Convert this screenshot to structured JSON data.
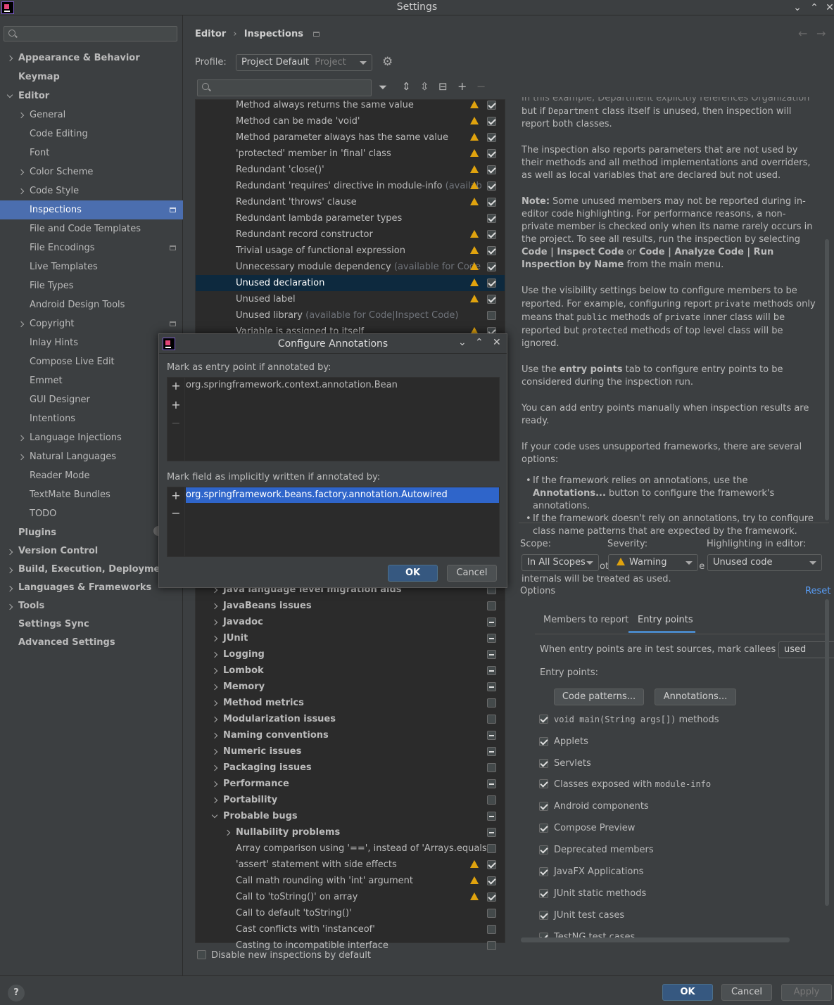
{
  "window": {
    "title": "Settings"
  },
  "search": {
    "placeholder": ""
  },
  "sidebar": {
    "items": [
      {
        "label": "Appearance & Behavior",
        "level": 0,
        "bold": true,
        "expand": "collapsed"
      },
      {
        "label": "Keymap",
        "level": 0,
        "bold": true
      },
      {
        "label": "Editor",
        "level": 0,
        "bold": true,
        "expand": "expanded"
      },
      {
        "label": "General",
        "level": 1,
        "expand": "collapsed"
      },
      {
        "label": "Code Editing",
        "level": 1
      },
      {
        "label": "Font",
        "level": 1
      },
      {
        "label": "Color Scheme",
        "level": 1,
        "expand": "collapsed"
      },
      {
        "label": "Code Style",
        "level": 1,
        "expand": "collapsed"
      },
      {
        "label": "Inspections",
        "level": 1,
        "selected": true,
        "project": true
      },
      {
        "label": "File and Code Templates",
        "level": 1
      },
      {
        "label": "File Encodings",
        "level": 1,
        "project": true
      },
      {
        "label": "Live Templates",
        "level": 1
      },
      {
        "label": "File Types",
        "level": 1
      },
      {
        "label": "Android Design Tools",
        "level": 1
      },
      {
        "label": "Copyright",
        "level": 1,
        "expand": "collapsed",
        "project": true
      },
      {
        "label": "Inlay Hints",
        "level": 1
      },
      {
        "label": "Compose Live Edit",
        "level": 1
      },
      {
        "label": "Emmet",
        "level": 1
      },
      {
        "label": "GUI Designer",
        "level": 1
      },
      {
        "label": "Intentions",
        "level": 1
      },
      {
        "label": "Language Injections",
        "level": 1,
        "expand": "collapsed"
      },
      {
        "label": "Natural Languages",
        "level": 1,
        "expand": "collapsed"
      },
      {
        "label": "Reader Mode",
        "level": 1
      },
      {
        "label": "TextMate Bundles",
        "level": 1
      },
      {
        "label": "TODO",
        "level": 1
      },
      {
        "label": "Plugins",
        "level": 0,
        "bold": true
      },
      {
        "label": "Version Control",
        "level": 0,
        "bold": true,
        "expand": "collapsed"
      },
      {
        "label": "Build, Execution, Deployment",
        "level": 0,
        "bold": true,
        "expand": "collapsed"
      },
      {
        "label": "Languages & Frameworks",
        "level": 0,
        "bold": true,
        "expand": "collapsed"
      },
      {
        "label": "Tools",
        "level": 0,
        "bold": true,
        "expand": "collapsed"
      },
      {
        "label": "Settings Sync",
        "level": 0,
        "bold": true
      },
      {
        "label": "Advanced Settings",
        "level": 0,
        "bold": true
      }
    ]
  },
  "breadcrumb": {
    "parent": "Editor",
    "current": "Inspections",
    "sep": "›"
  },
  "profile": {
    "label": "Profile:",
    "value": "Project Default",
    "scope": "Project"
  },
  "filter": {
    "placeholder": ""
  },
  "inspections_top": [
    {
      "label": "Method always returns the same value",
      "warn": true,
      "check": "on"
    },
    {
      "label": "Method can be made 'void'",
      "warn": true,
      "check": "on"
    },
    {
      "label": "Method parameter always has the same value",
      "warn": true,
      "check": "on"
    },
    {
      "label": "'protected' member in 'final' class",
      "warn": true,
      "check": "on"
    },
    {
      "label": "Redundant 'close()'",
      "warn": true,
      "check": "on"
    },
    {
      "label": "Redundant 'requires' directive in module-info",
      "suffix": " (availab",
      "warn": true,
      "check": "on"
    },
    {
      "label": "Redundant 'throws' clause",
      "warn": true,
      "check": "on"
    },
    {
      "label": "Redundant lambda parameter types",
      "warn": false,
      "check": "on"
    },
    {
      "label": "Redundant record constructor",
      "warn": true,
      "check": "on"
    },
    {
      "label": "Trivial usage of functional expression",
      "warn": true,
      "check": "on"
    },
    {
      "label": "Unnecessary module dependency",
      "suffix": " (available for Code",
      "warn": true,
      "check": "on"
    },
    {
      "label": "Unused declaration",
      "warn": true,
      "check": "on",
      "selected": true
    },
    {
      "label": "Unused label",
      "warn": true,
      "check": "on"
    },
    {
      "label": "Unused library",
      "suffix": " (available for Code|Inspect Code)",
      "warn": false,
      "check": "off"
    },
    {
      "label": "Variable is assigned to itself",
      "warn": true,
      "check": "on"
    }
  ],
  "inspections_bottom": [
    {
      "label": "Java language level migration aids",
      "group": true,
      "check": "off"
    },
    {
      "label": "JavaBeans issues",
      "group": true,
      "check": "off"
    },
    {
      "label": "Javadoc",
      "group": true,
      "check": "mix"
    },
    {
      "label": "JUnit",
      "group": true,
      "check": "mix"
    },
    {
      "label": "Logging",
      "group": true,
      "check": "mix"
    },
    {
      "label": "Lombok",
      "group": true,
      "check": "mix"
    },
    {
      "label": "Memory",
      "group": true,
      "check": "mix"
    },
    {
      "label": "Method metrics",
      "group": true,
      "check": "off"
    },
    {
      "label": "Modularization issues",
      "group": true,
      "check": "off"
    },
    {
      "label": "Naming conventions",
      "group": true,
      "check": "mix"
    },
    {
      "label": "Numeric issues",
      "group": true,
      "check": "mix"
    },
    {
      "label": "Packaging issues",
      "group": true,
      "check": "off"
    },
    {
      "label": "Performance",
      "group": true,
      "check": "mix"
    },
    {
      "label": "Portability",
      "group": true,
      "check": "off"
    },
    {
      "label": "Probable bugs",
      "group": true,
      "expanded": true,
      "check": "mix"
    },
    {
      "label": "Nullability problems",
      "group": true,
      "sub": true,
      "check": "mix"
    },
    {
      "label": "Array comparison using '==', instead of 'Arrays.equals",
      "check": "off"
    },
    {
      "label": "'assert' statement with side effects",
      "warn": true,
      "check": "on"
    },
    {
      "label": "Call math rounding with 'int' argument",
      "warn": true,
      "check": "on"
    },
    {
      "label": "Call to 'toString()' on array",
      "warn": true,
      "check": "on"
    },
    {
      "label": "Call to default 'toString()'",
      "check": "off"
    },
    {
      "label": "Cast conflicts with 'instanceof'",
      "check": "off"
    },
    {
      "label": "Casting to incompatible interface",
      "check": "off"
    }
  ],
  "disable_new": {
    "label": "Disable new inspections by default",
    "checked": false
  },
  "description": {
    "p0_cut": "In this example, Department explicitly references Organization",
    "p0_a": "but if ",
    "p0_code": "Department",
    "p0_b": " class itself is unused, then inspection will report both classes.",
    "p1": "The inspection also reports parameters that are not used by their methods and all method implementations and overriders, as well as local variables that are declared but not used.",
    "p2_note": "Note:",
    "p2_a": " Some unused members may not be reported during in-editor code highlighting. For performance reasons, a non-private member is checked only when its name rarely occurs in the project. To see all results, run the inspection by selecting ",
    "p2_b1": "Code | Inspect Code",
    "p2_or": " or ",
    "p2_b2": "Code | Analyze Code | Run Inspection by Name",
    "p2_c": " from the main menu.",
    "p3_a": "Use the visibility settings below to configure members to be reported. For example, configuring report ",
    "p3_c1": "private",
    "p3_b": " methods only means that ",
    "p3_c2": "public",
    "p3_d": " methods of ",
    "p3_c3": "private",
    "p3_e": " inner class will be reported but ",
    "p3_c4": "protected",
    "p3_f": " methods of top level class will be ignored.",
    "p4_a": "Use the ",
    "p4_b": "entry points",
    "p4_c": " tab to configure entry points to be considered during the inspection run.",
    "p5": "You can add entry points manually when inspection results are ready.",
    "p6": "If your code uses unsupported frameworks, there are several options:",
    "b1_a": "If the framework relies on annotations, use the ",
    "b1_b": "Annotations...",
    "b1_c": " button to configure the framework's annotations.",
    "b2": "If the framework doesn't rely on annotations, try to configure class name patterns that are expected by the framework.",
    "p7": "This way the annotated code accessible by the framework internals will be treated as used."
  },
  "scope": {
    "label": "Scope:",
    "value": "In All Scopes"
  },
  "severity": {
    "label": "Severity:",
    "value": "Warning"
  },
  "highlight": {
    "label": "Highlighting in editor:",
    "value": "Unused code"
  },
  "options": {
    "label": "Options",
    "reset": "Reset"
  },
  "tabs": {
    "members": "Members to report",
    "entry": "Entry points"
  },
  "entry": {
    "test_label": "When entry points are in test sources, mark callees as:",
    "test_value": "used",
    "points_label": "Entry points:",
    "code_patterns": "Code patterns...",
    "annotations": "Annotations...",
    "main_code": "void main(String args[])",
    "main_suffix": " methods",
    "module_prefix": "Classes exposed with ",
    "module_code": "module-info",
    "items": [
      "Applets",
      "Servlets",
      "Android components",
      "Compose Preview",
      "Deprecated members",
      "JavaFX Applications",
      "JUnit static methods",
      "JUnit test cases",
      "TestNG test cases"
    ]
  },
  "dialog": {
    "title": "Configure Annotations",
    "label1": "Mark as entry point if annotated by:",
    "list1": [
      "org.springframework.context.annotation.Bean"
    ],
    "label2": "Mark field as implicitly written if annotated by:",
    "list2": [
      "org.springframework.beans.factory.annotation.Autowired"
    ],
    "ok": "OK",
    "cancel": "Cancel"
  },
  "footer": {
    "help": "?",
    "ok": "OK",
    "cancel": "Cancel",
    "apply": "Apply"
  },
  "colors": {
    "selection": "#4b6eaf",
    "tree_selection": "#0d293e",
    "warning": "#e0a30e",
    "link": "#589df6",
    "primary_button": "#365880"
  }
}
